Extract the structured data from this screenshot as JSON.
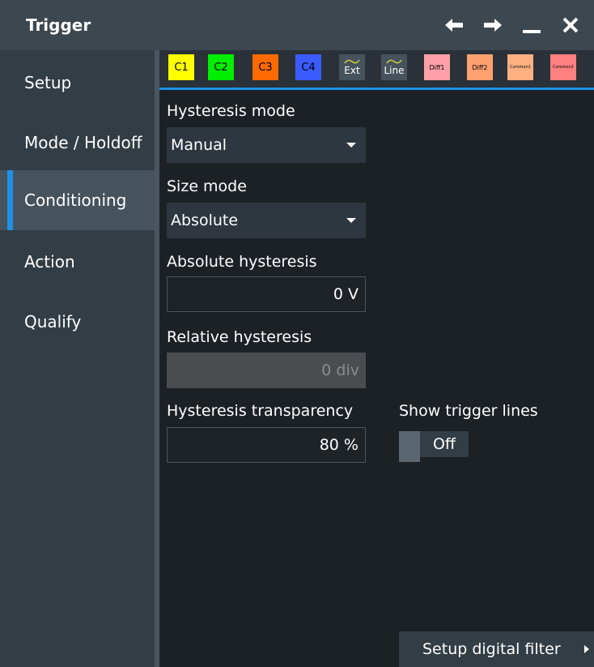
{
  "window": {
    "title": "Trigger"
  },
  "sidebar": {
    "items": [
      {
        "label": "Setup"
      },
      {
        "label": "Mode / Holdoff"
      },
      {
        "label": "Conditioning"
      },
      {
        "label": "Action"
      },
      {
        "label": "Qualify"
      }
    ],
    "active": "Conditioning"
  },
  "tabs": [
    {
      "label": "C1",
      "color": "#ffff00"
    },
    {
      "label": "C2",
      "color": "#00ee00"
    },
    {
      "label": "C3",
      "color": "#ff6a00"
    },
    {
      "label": "C4",
      "color": "#3a5bff"
    },
    {
      "label": "Ext",
      "icon": "wave-icon"
    },
    {
      "label": "Line",
      "icon": "wave-icon"
    },
    {
      "label": "Diff1",
      "color": "#ffa0a8"
    },
    {
      "label": "Diff2",
      "color": "#ffa070"
    },
    {
      "label": "Common1",
      "color": "#ffb080"
    },
    {
      "label": "Common2",
      "color": "#ff8080"
    }
  ],
  "form": {
    "hysteresis_mode": {
      "label": "Hysteresis mode",
      "value": "Manual"
    },
    "size_mode": {
      "label": "Size mode",
      "value": "Absolute"
    },
    "absolute_hysteresis": {
      "label": "Absolute hysteresis",
      "value": "0 V"
    },
    "relative_hysteresis": {
      "label": "Relative hysteresis",
      "value": "0 div"
    },
    "hysteresis_transparency": {
      "label": "Hysteresis transparency",
      "value": "80 %"
    },
    "show_trigger_lines": {
      "label": "Show trigger lines",
      "value": "Off"
    }
  },
  "footer": {
    "setup_digital_filter": "Setup digital filter"
  },
  "colors": {
    "accent": "#1e90e6",
    "background": "#1c2126",
    "panel": "#333d45"
  }
}
